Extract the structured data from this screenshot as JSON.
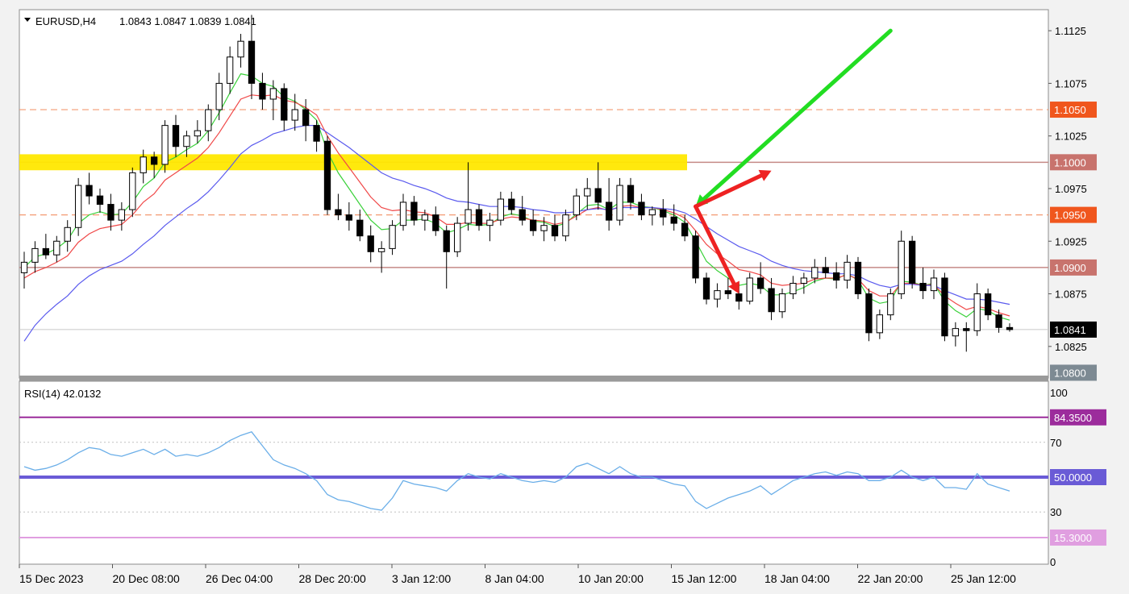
{
  "main_header": {
    "symbol": "EURUSD,H4",
    "ohlc": "1.0843 1.0847 1.0839 1.0841"
  },
  "rsi_header": {
    "label": "RSI(14) 42.0132"
  },
  "colors": {
    "bull": "#ffffff",
    "bear": "#000000",
    "wick": "#000000",
    "ma_fast": "#3ad13a",
    "ma_mid": "#f04848",
    "ma_slow": "#5a5aee",
    "zone": "#ffe800",
    "level_solid": "#c58a86",
    "level_dashed": "#f39a72",
    "badge_orange": "#f0561d",
    "badge_rose": "#c8736d",
    "badge_gray": "#7d8a93",
    "badge_black": "#000000",
    "rsi_line": "#6aaee8",
    "rsi_50": "#6a5bd6",
    "rsi_upper": "#9c2c9c",
    "rsi_lower": "#e09ee0",
    "arrow_green": "#22dd22",
    "arrow_red": "#ee2222"
  },
  "chart_data": [
    {
      "type": "candlestick",
      "symbol": "EURUSD",
      "timeframe": "H4",
      "ylim": [
        1.0795,
        1.1145
      ],
      "y_ticks": [
        "1.1125",
        "1.1075",
        "1.1025",
        "1.0975",
        "1.0925",
        "1.0875",
        "1.0825"
      ],
      "x_ticks": [
        "15 Dec 2023",
        "20 Dec 08:00",
        "26 Dec 04:00",
        "28 Dec 20:00",
        "3 Jan 12:00",
        "8 Jan 04:00",
        "10 Jan 20:00",
        "15 Jan 12:00",
        "18 Jan 04:00",
        "22 Jan 20:00",
        "25 Jan 12:00"
      ],
      "levels": [
        {
          "value": 1.105,
          "label": "1.1050",
          "style": "dashed",
          "badge": "orange"
        },
        {
          "value": 1.1,
          "label": "1.1000",
          "style": "solid",
          "badge": "rose"
        },
        {
          "value": 1.095,
          "label": "1.0950",
          "style": "dashed",
          "badge": "orange"
        },
        {
          "value": 1.09,
          "label": "1.0900",
          "style": "solid",
          "badge": "rose"
        },
        {
          "value": 1.0841,
          "label": "1.0841",
          "style": "thin",
          "badge": "black"
        },
        {
          "value": 1.08,
          "label": "1.0800",
          "style": "none",
          "badge": "gray"
        }
      ],
      "zone": {
        "from": 1.0997,
        "to": 1.1003
      },
      "ohlc": [
        [
          1.0895,
          1.0915,
          1.088,
          1.0905
        ],
        [
          1.0905,
          1.0925,
          1.0895,
          1.0918
        ],
        [
          1.0918,
          1.0932,
          1.0908,
          1.0912
        ],
        [
          1.0912,
          1.093,
          1.0905,
          1.0925
        ],
        [
          1.0925,
          1.0945,
          1.0915,
          1.0938
        ],
        [
          1.0938,
          1.0985,
          1.093,
          1.0978
        ],
        [
          1.0978,
          1.099,
          1.096,
          1.0968
        ],
        [
          1.0968,
          1.0975,
          1.0952,
          1.096
        ],
        [
          1.096,
          1.097,
          1.0935,
          1.0945
        ],
        [
          1.0945,
          1.0962,
          1.0935,
          1.0955
        ],
        [
          1.0955,
          1.0995,
          1.0948,
          1.099
        ],
        [
          1.099,
          1.1012,
          1.098,
          1.1005
        ],
        [
          1.1005,
          1.101,
          1.0985,
          1.0998
        ],
        [
          1.0998,
          1.104,
          1.099,
          1.1035
        ],
        [
          1.1035,
          1.1045,
          1.1005,
          1.1015
        ],
        [
          1.1015,
          1.103,
          1.1005,
          1.1025
        ],
        [
          1.1025,
          1.104,
          1.1018,
          1.103
        ],
        [
          1.103,
          1.1055,
          1.102,
          1.105
        ],
        [
          1.105,
          1.1085,
          1.104,
          1.1075
        ],
        [
          1.1075,
          1.111,
          1.1065,
          1.11
        ],
        [
          1.11,
          1.1122,
          1.109,
          1.1115
        ],
        [
          1.1115,
          1.114,
          1.106,
          1.1075
        ],
        [
          1.1075,
          1.1085,
          1.105,
          1.106
        ],
        [
          1.106,
          1.1078,
          1.104,
          1.107
        ],
        [
          1.107,
          1.1075,
          1.103,
          1.104
        ],
        [
          1.104,
          1.1065,
          1.103,
          1.105
        ],
        [
          1.105,
          1.106,
          1.102,
          1.1035
        ],
        [
          1.1035,
          1.104,
          1.101,
          1.102
        ],
        [
          1.102,
          1.1025,
          1.095,
          1.0955
        ],
        [
          1.0955,
          1.097,
          1.0945,
          1.095
        ],
        [
          1.095,
          1.0962,
          1.0935,
          1.0945
        ],
        [
          1.0945,
          1.0955,
          1.0925,
          1.093
        ],
        [
          1.093,
          1.094,
          1.0905,
          1.0915
        ],
        [
          1.0915,
          1.0925,
          1.0895,
          1.0918
        ],
        [
          1.0918,
          1.0945,
          1.0912,
          1.094
        ],
        [
          1.094,
          1.097,
          1.0935,
          1.0962
        ],
        [
          1.0962,
          1.0968,
          1.094,
          1.0945
        ],
        [
          1.0945,
          1.0955,
          1.0935,
          1.095
        ],
        [
          1.095,
          1.0958,
          1.093,
          1.0935
        ],
        [
          1.0935,
          1.094,
          1.088,
          1.0915
        ],
        [
          1.0915,
          1.0948,
          1.091,
          1.0942
        ],
        [
          1.0942,
          1.1,
          1.0935,
          1.0955
        ],
        [
          1.0955,
          1.096,
          1.0935,
          1.094
        ],
        [
          1.094,
          1.0952,
          1.0925,
          1.0945
        ],
        [
          1.0945,
          1.0972,
          1.094,
          1.0965
        ],
        [
          1.0965,
          1.0972,
          1.095,
          1.0955
        ],
        [
          1.0955,
          1.0968,
          1.094,
          1.0945
        ],
        [
          1.0945,
          1.0955,
          1.093,
          1.0935
        ],
        [
          1.0935,
          1.0948,
          1.0925,
          1.094
        ],
        [
          1.094,
          1.095,
          1.0925,
          1.093
        ],
        [
          1.093,
          1.0955,
          1.0925,
          1.095
        ],
        [
          1.095,
          1.0975,
          1.0945,
          1.0968
        ],
        [
          1.0968,
          1.0985,
          1.0955,
          1.0975
        ],
        [
          1.0975,
          1.1,
          1.0955,
          1.0962
        ],
        [
          1.0962,
          1.0985,
          1.0935,
          1.0945
        ],
        [
          1.0945,
          1.0985,
          1.094,
          1.0978
        ],
        [
          1.0978,
          1.0985,
          1.0955,
          1.0962
        ],
        [
          1.0962,
          1.097,
          1.0945,
          1.095
        ],
        [
          1.095,
          1.0958,
          1.094,
          1.0955
        ],
        [
          1.0955,
          1.0965,
          1.094,
          1.0948
        ],
        [
          1.0948,
          1.096,
          1.0935,
          1.0942
        ],
        [
          1.0942,
          1.095,
          1.0925,
          1.093
        ],
        [
          1.093,
          1.0935,
          1.0885,
          1.089
        ],
        [
          1.089,
          1.0895,
          1.0865,
          1.087
        ],
        [
          1.087,
          1.0885,
          1.0862,
          1.0878
        ],
        [
          1.0878,
          1.089,
          1.087,
          1.0875
        ],
        [
          1.0875,
          1.0885,
          1.086,
          1.0868
        ],
        [
          1.0868,
          1.0895,
          1.0865,
          1.089
        ],
        [
          1.089,
          1.0905,
          1.0875,
          1.088
        ],
        [
          1.088,
          1.089,
          1.085,
          1.0858
        ],
        [
          1.0858,
          1.088,
          1.0852,
          1.0875
        ],
        [
          1.0875,
          1.0892,
          1.087,
          1.0885
        ],
        [
          1.0885,
          1.0895,
          1.0875,
          1.089
        ],
        [
          1.089,
          1.0908,
          1.0885,
          1.09
        ],
        [
          1.09,
          1.091,
          1.089,
          1.0895
        ],
        [
          1.0895,
          1.0905,
          1.088,
          1.0888
        ],
        [
          1.0888,
          1.0912,
          1.088,
          1.0905
        ],
        [
          1.0905,
          1.091,
          1.087,
          1.0875
        ],
        [
          1.0875,
          1.088,
          1.083,
          1.0838
        ],
        [
          1.0838,
          1.086,
          1.0832,
          1.0855
        ],
        [
          1.0855,
          1.088,
          1.085,
          1.0875
        ],
        [
          1.0875,
          1.0935,
          1.087,
          1.0925
        ],
        [
          1.0925,
          1.093,
          1.088,
          1.0885
        ],
        [
          1.0885,
          1.09,
          1.087,
          1.0878
        ],
        [
          1.0878,
          1.0898,
          1.087,
          1.089
        ],
        [
          1.089,
          1.0895,
          1.083,
          1.0835
        ],
        [
          1.0835,
          1.0848,
          1.0825,
          1.0842
        ],
        [
          1.0842,
          1.0848,
          1.082,
          1.084
        ],
        [
          1.084,
          1.0885,
          1.0835,
          1.0875
        ],
        [
          1.0875,
          1.088,
          1.085,
          1.0855
        ],
        [
          1.0855,
          1.086,
          1.0838,
          1.0843
        ],
        [
          1.0843,
          1.0847,
          1.0839,
          1.0841
        ]
      ],
      "moving_averages": [
        {
          "name": "fast",
          "values": [
            1.09,
            1.091,
            1.0913,
            1.0918,
            1.0926,
            1.0942,
            1.095,
            1.0953,
            1.095,
            1.0951,
            1.0962,
            1.0977,
            1.0985,
            1.1,
            1.1005,
            1.1012,
            1.1018,
            1.103,
            1.1047,
            1.1066,
            1.1084,
            1.1082,
            1.1075,
            1.1072,
            1.1062,
            1.1058,
            1.105,
            1.104,
            1.101,
            1.099,
            1.0975,
            1.096,
            1.0945,
            1.0936,
            1.0937,
            1.0945,
            1.0945,
            1.0946,
            1.0942,
            1.0933,
            1.0936,
            1.0941,
            1.094,
            1.0941,
            1.0948,
            1.0951,
            1.0949,
            1.0944,
            1.0943,
            1.0939,
            1.0942,
            1.0951,
            1.0959,
            1.096,
            1.0955,
            1.0962,
            1.0962,
            1.0958,
            1.0957,
            1.0954,
            1.095,
            1.0943,
            1.0925,
            1.0906,
            1.0897,
            1.089,
            1.0883,
            1.0885,
            1.0883,
            1.0874,
            1.0874,
            1.0877,
            1.0881,
            1.0887,
            1.089,
            1.0889,
            1.0894,
            1.0888,
            1.0871,
            1.0866,
            1.0868,
            1.0887,
            1.0886,
            1.0883,
            1.0885,
            1.0868,
            1.0859,
            1.0853,
            1.0861,
            1.0859,
            1.0853,
            1.085
          ]
        },
        {
          "name": "mid",
          "values": [
            1.089,
            1.0896,
            1.09,
            1.0905,
            1.0911,
            1.0924,
            1.0932,
            1.0937,
            1.0939,
            1.0941,
            1.095,
            1.0962,
            1.097,
            1.0983,
            1.099,
            1.0997,
            1.1004,
            1.1014,
            1.1028,
            1.1044,
            1.106,
            1.1064,
            1.1063,
            1.1064,
            1.1059,
            1.1057,
            1.1052,
            1.1045,
            1.1025,
            1.1009,
            1.0995,
            1.0981,
            1.0967,
            1.0957,
            1.0954,
            1.0955,
            1.0953,
            1.0952,
            1.0948,
            1.0941,
            1.0941,
            1.0943,
            1.0942,
            1.0942,
            1.0946,
            1.0948,
            1.0947,
            1.0945,
            1.0944,
            1.0941,
            1.0943,
            1.0949,
            1.0955,
            1.0957,
            1.0954,
            1.0958,
            1.0959,
            1.0957,
            1.0957,
            1.0955,
            1.0952,
            1.0947,
            1.0935,
            1.0922,
            1.0913,
            1.0906,
            1.0898,
            1.0896,
            1.0893,
            1.0885,
            1.0883,
            1.0884,
            1.0885,
            1.0889,
            1.089,
            1.089,
            1.0893,
            1.0889,
            1.0878,
            1.0873,
            1.0873,
            1.0885,
            1.0885,
            1.0883,
            1.0884,
            1.0873,
            1.0866,
            1.086,
            1.0863,
            1.0861,
            1.0857,
            1.0854
          ]
        },
        {
          "name": "slow",
          "values": [
            1.083,
            1.0845,
            1.0856,
            1.0865,
            1.0873,
            1.0884,
            1.0892,
            1.0898,
            1.0902,
            1.0906,
            1.0913,
            1.0922,
            1.093,
            1.094,
            1.0948,
            1.0956,
            1.0963,
            1.0972,
            1.0983,
            1.0995,
            1.1008,
            1.1016,
            1.1021,
            1.1027,
            1.103,
            1.1033,
            1.1035,
            1.1035,
            1.1028,
            1.1021,
            1.1014,
            1.1006,
            1.0998,
            1.099,
            1.0985,
            1.0982,
            1.0978,
            1.0975,
            1.0971,
            1.0966,
            1.0963,
            1.0962,
            1.096,
            1.0958,
            1.0958,
            1.0958,
            1.0957,
            1.0955,
            1.0954,
            1.0952,
            1.0952,
            1.0953,
            1.0955,
            1.0956,
            1.0955,
            1.0957,
            1.0957,
            1.0957,
            1.0957,
            1.0956,
            1.0955,
            1.0952,
            1.0946,
            1.0939,
            1.0932,
            1.0926,
            1.092,
            1.0916,
            1.0912,
            1.0906,
            1.0902,
            1.0899,
            1.0897,
            1.0896,
            1.0895,
            1.0894,
            1.0894,
            1.0892,
            1.0887,
            1.0883,
            1.0881,
            1.0884,
            1.0884,
            1.0883,
            1.0883,
            1.0878,
            1.0874,
            1.087,
            1.087,
            1.0869,
            1.0867,
            1.0865
          ]
        }
      ],
      "annotations": [
        {
          "type": "arrow",
          "color": "green",
          "from": [
            80,
            1.1125
          ],
          "to": [
            62,
            1.0958
          ]
        },
        {
          "type": "arrow",
          "color": "red",
          "from": [
            62,
            1.0958
          ],
          "to": [
            69,
            1.0992
          ]
        },
        {
          "type": "arrow",
          "color": "red",
          "from": [
            62,
            1.0958
          ],
          "to": [
            66,
            1.0875
          ]
        }
      ]
    },
    {
      "type": "line",
      "name": "RSI(14)",
      "ylim": [
        0,
        100
      ],
      "y_ticks": [
        "100",
        "70",
        "30",
        "0"
      ],
      "levels": [
        {
          "value": 84.35,
          "label": "84.3500",
          "badge": "purple"
        },
        {
          "value": 50,
          "label": "50.0000",
          "badge": "blue"
        },
        {
          "value": 15.3,
          "label": "15.3000",
          "badge": "pink"
        }
      ],
      "values": [
        56,
        54,
        55,
        57,
        60,
        64,
        67,
        66,
        63,
        62,
        64,
        66,
        63,
        66,
        62,
        63,
        62,
        64,
        67,
        71,
        74,
        76,
        68,
        60,
        57,
        55,
        52,
        48,
        40,
        37,
        36,
        34,
        32,
        31,
        38,
        48,
        46,
        45,
        44,
        42,
        48,
        52,
        50,
        49,
        52,
        50,
        48,
        47,
        48,
        47,
        50,
        56,
        58,
        55,
        52,
        56,
        52,
        50,
        50,
        48,
        46,
        45,
        36,
        32,
        35,
        38,
        40,
        42,
        45,
        40,
        44,
        48,
        50,
        52,
        53,
        51,
        53,
        52,
        48,
        48,
        50,
        54,
        50,
        48,
        50,
        44,
        44,
        43,
        52,
        46,
        44,
        42
      ]
    }
  ]
}
